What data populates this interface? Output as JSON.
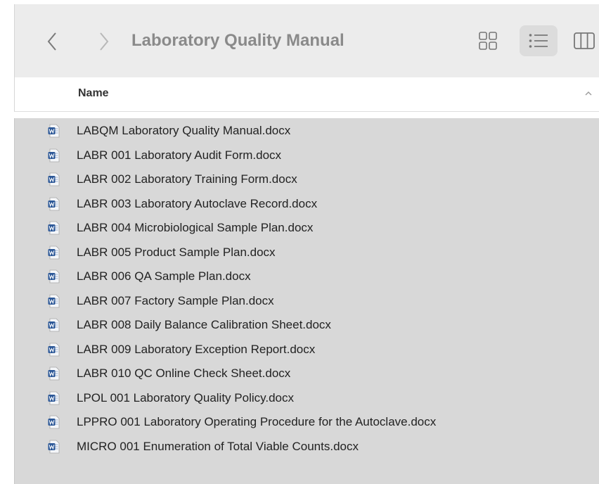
{
  "window": {
    "folder_title": "Laboratory Quality Manual",
    "accent_color": "#2b5797"
  },
  "toolbar": {
    "back_icon": "chevron-left-icon",
    "forward_icon": "chevron-right-icon",
    "views": [
      {
        "name": "icon-view",
        "icon": "grid-icon",
        "selected": false
      },
      {
        "name": "list-view",
        "icon": "list-icon",
        "selected": true
      },
      {
        "name": "column-view",
        "icon": "columns-icon",
        "selected": false
      }
    ]
  },
  "list_header": {
    "name_label": "Name",
    "sort_direction": "ascending"
  },
  "files": [
    {
      "name": "LABQM Laboratory Quality Manual.docx",
      "icon": "word-document-icon"
    },
    {
      "name": "LABR 001 Laboratory Audit Form.docx",
      "icon": "word-document-icon"
    },
    {
      "name": "LABR 002 Laboratory Training Form.docx",
      "icon": "word-document-icon"
    },
    {
      "name": "LABR 003 Laboratory Autoclave Record.docx",
      "icon": "word-document-icon"
    },
    {
      "name": "LABR 004 Microbiological Sample Plan.docx",
      "icon": "word-document-icon"
    },
    {
      "name": "LABR 005 Product Sample Plan.docx",
      "icon": "word-document-icon"
    },
    {
      "name": "LABR 006 QA Sample Plan.docx",
      "icon": "word-document-icon"
    },
    {
      "name": "LABR 007 Factory Sample Plan.docx",
      "icon": "word-document-icon"
    },
    {
      "name": "LABR 008 Daily Balance Calibration Sheet.docx",
      "icon": "word-document-icon"
    },
    {
      "name": "LABR 009 Laboratory Exception Report.docx",
      "icon": "word-document-icon"
    },
    {
      "name": "LABR 010 QC Online Check Sheet.docx",
      "icon": "word-document-icon"
    },
    {
      "name": "LPOL 001 Laboratory Quality Policy.docx",
      "icon": "word-document-icon"
    },
    {
      "name": "LPPRO 001 Laboratory Operating Procedure for the Autoclave.docx",
      "icon": "word-document-icon"
    },
    {
      "name": "MICRO 001 Enumeration of Total Viable Counts.docx",
      "icon": "word-document-icon"
    }
  ]
}
